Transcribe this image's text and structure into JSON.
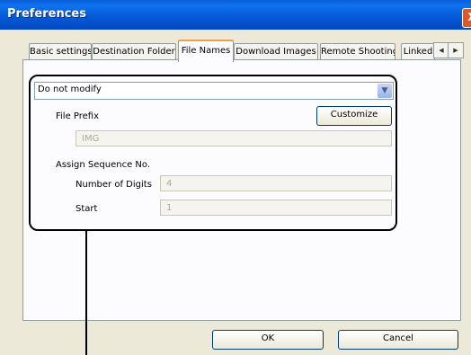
{
  "window": {
    "title": "Preferences",
    "close_label": "X"
  },
  "tabs": [
    {
      "label": "Basic settings"
    },
    {
      "label": "Destination Folder"
    },
    {
      "label": "File Names"
    },
    {
      "label": "Download Images"
    },
    {
      "label": "Remote Shooting"
    },
    {
      "label": "Linked"
    }
  ],
  "tab_scroll": {
    "left": "◀",
    "right": "▶"
  },
  "file_names": {
    "mode_value": "Do not modify",
    "dropdown_arrow": "▼",
    "file_prefix_label": "File Prefix",
    "customize_label": "Customize",
    "file_prefix_value": "IMG",
    "sequence_label": "Assign Sequence No.",
    "digits_label": "Number of Digits",
    "digits_value": "4",
    "start_label": "Start",
    "start_value": "1"
  },
  "footer": {
    "ok_label": "OK",
    "cancel_label": "Cancel"
  }
}
